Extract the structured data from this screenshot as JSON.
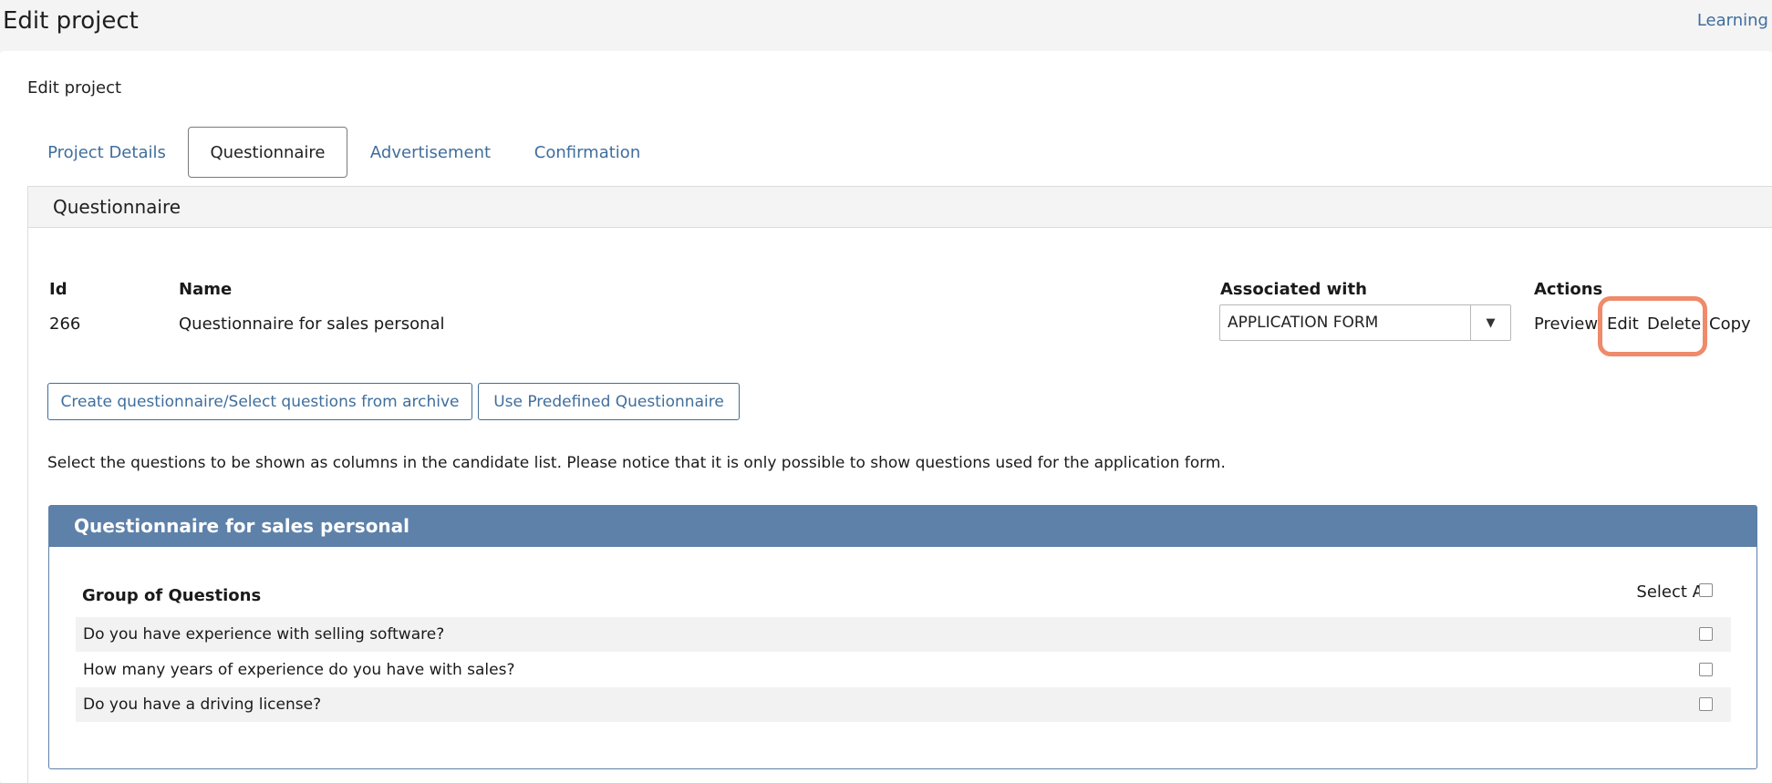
{
  "header": {
    "title": "Edit project",
    "link": "Learning"
  },
  "card": {
    "subtitle": "Edit project"
  },
  "tabs": [
    {
      "label": "Project Details",
      "active": false
    },
    {
      "label": "Questionnaire",
      "active": true
    },
    {
      "label": "Advertisement",
      "active": false
    },
    {
      "label": "Confirmation",
      "active": false
    }
  ],
  "panel": {
    "title": "Questionnaire"
  },
  "table": {
    "headers": {
      "id": "Id",
      "name": "Name",
      "associated": "Associated with",
      "actions": "Actions"
    },
    "row": {
      "id": "266",
      "name": "Questionnaire for sales personal",
      "associated": "APPLICATION FORM"
    },
    "actions": [
      "Preview",
      "Edit",
      "Delete",
      "Copy"
    ]
  },
  "buttons": {
    "create": "Create questionnaire/Select questions from archive",
    "predefined": "Use Predefined Questionnaire"
  },
  "info_text": "Select the questions to be shown as columns in the candidate list. Please notice that it is only possible to show questions used for the application form.",
  "questionnaire_box": {
    "title": "Questionnaire for sales personal",
    "group_label": "Group of Questions",
    "select_all": "Select All",
    "questions": [
      "Do you have experience with selling software?",
      "How many years of experience do you have with sales?",
      "Do you have a driving license?"
    ]
  },
  "colors": {
    "link": "#3f6e9c",
    "box_header": "#5e81a9",
    "highlight": "#ef8a6a"
  }
}
